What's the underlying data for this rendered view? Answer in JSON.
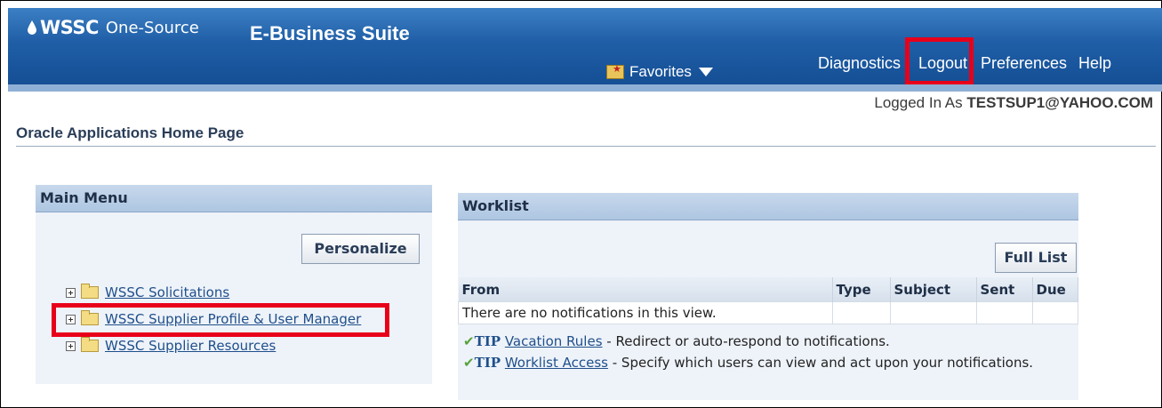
{
  "header": {
    "brand": "WSSC",
    "brand_sub": "One-Source",
    "suite": "E-Business Suite",
    "favorites_label": "Favorites",
    "nav": {
      "diagnostics": "Diagnostics",
      "logout": "Logout",
      "preferences": "Preferences",
      "help": "Help"
    }
  },
  "session": {
    "logged_in_prefix": "Logged In As",
    "user": "TESTSUP1@YAHOO.COM"
  },
  "page": {
    "title": "Oracle Applications Home Page"
  },
  "main_menu": {
    "title": "Main Menu",
    "personalize_label": "Personalize",
    "items": [
      {
        "label": "WSSC Solicitations"
      },
      {
        "label": "WSSC Supplier Profile & User Manager"
      },
      {
        "label": "WSSC Supplier Resources"
      }
    ]
  },
  "worklist": {
    "title": "Worklist",
    "full_list_label": "Full List",
    "columns": [
      "From",
      "Type",
      "Subject",
      "Sent",
      "Due"
    ],
    "empty_message": "There are no notifications in this view.",
    "tips": [
      {
        "tag": "TIP",
        "link": "Vacation Rules",
        "text": " - Redirect or auto-respond to notifications."
      },
      {
        "tag": "TIP",
        "link": "Worklist Access",
        "text": " - Specify which users can view and act upon your notifications."
      }
    ]
  },
  "colors": {
    "header_blue": "#1f5ea6",
    "highlight_red": "#e8001a",
    "link_blue": "#1f4f8a"
  }
}
